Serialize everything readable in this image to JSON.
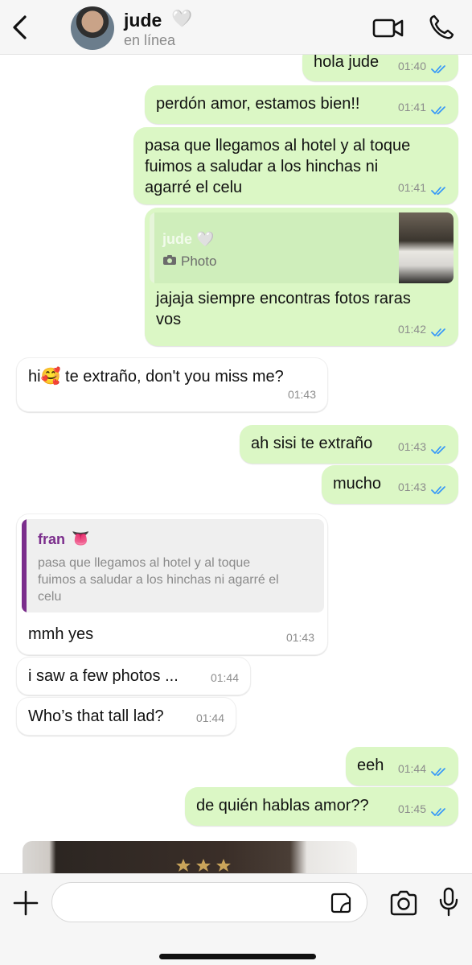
{
  "header": {
    "back_icon": "chevron-left-icon",
    "contact_name": "jude",
    "contact_emoji": "🤍",
    "status": "en línea",
    "video_icon": "video-camera-icon",
    "call_icon": "phone-icon"
  },
  "messages": [
    {
      "id": "m1",
      "dir": "out",
      "text": "hola jude",
      "time": "01:40",
      "read": true
    },
    {
      "id": "m2",
      "dir": "out",
      "text": "perdón amor, estamos bien!!",
      "time": "01:41",
      "read": true
    },
    {
      "id": "m3",
      "dir": "out",
      "lines": [
        "pasa que llegamos al hotel y al toque",
        "fuimos a saludar a los hinchas ni",
        "agarré el celu"
      ],
      "time": "01:41",
      "read": true
    },
    {
      "id": "m4",
      "dir": "out",
      "quote": {
        "author": "jude 🤍",
        "type_icon": "camera-icon",
        "type_label": "Photo"
      },
      "lines": [
        "jajaja siempre encontras fotos raras",
        "vos"
      ],
      "time": "01:42",
      "read": true
    },
    {
      "id": "m5",
      "dir": "in",
      "text_before": "hi",
      "emoji": "🥰",
      "text_after": " te extraño, don't you miss me?",
      "time": "01:43"
    },
    {
      "id": "m6",
      "dir": "out",
      "text": "ah sisi te extraño",
      "time": "01:43",
      "read": true
    },
    {
      "id": "m7",
      "dir": "out",
      "text": "mucho",
      "time": "01:43",
      "read": true
    },
    {
      "id": "m8",
      "dir": "in",
      "quote": {
        "author": "fran",
        "author_emoji": "👅",
        "lines": [
          "pasa que llegamos al hotel y al toque",
          "fuimos a saludar a los hinchas ni agarré el",
          "celu"
        ]
      },
      "text": "mmh yes",
      "time": "01:43"
    },
    {
      "id": "m9",
      "dir": "in",
      "text": "i saw a few photos ...",
      "time": "01:44"
    },
    {
      "id": "m10",
      "dir": "in",
      "text": "Who’s that tall lad?",
      "time": "01:44"
    },
    {
      "id": "m11",
      "dir": "out",
      "text": "eeh",
      "time": "01:44",
      "read": true
    },
    {
      "id": "m12",
      "dir": "out",
      "text": "de quién hablas amor??",
      "time": "01:45",
      "read": true
    }
  ],
  "composer": {
    "plus_icon": "plus-icon",
    "input_value": "",
    "sticker_icon": "sticker-icon",
    "camera_icon": "camera-icon",
    "mic_icon": "microphone-icon"
  },
  "colors": {
    "outgoing_bubble": "#dbf7c5",
    "incoming_bubble": "#ffffff",
    "read_ticks": "#3497f9",
    "quote_bar_in": "#7b2d8c",
    "quote_author_in": "#7b2d8c",
    "icon": "#111111"
  }
}
